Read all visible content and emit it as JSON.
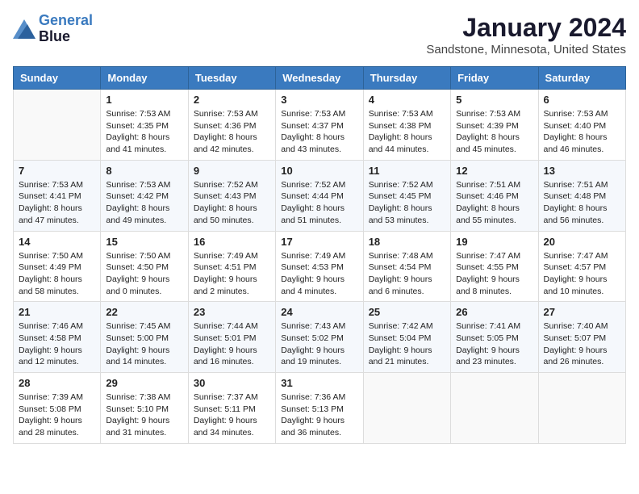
{
  "header": {
    "logo_line1": "General",
    "logo_line2": "Blue",
    "month": "January 2024",
    "location": "Sandstone, Minnesota, United States"
  },
  "days_of_week": [
    "Sunday",
    "Monday",
    "Tuesday",
    "Wednesday",
    "Thursday",
    "Friday",
    "Saturday"
  ],
  "weeks": [
    [
      {
        "day": "",
        "content": ""
      },
      {
        "day": "1",
        "content": "Sunrise: 7:53 AM\nSunset: 4:35 PM\nDaylight: 8 hours\nand 41 minutes."
      },
      {
        "day": "2",
        "content": "Sunrise: 7:53 AM\nSunset: 4:36 PM\nDaylight: 8 hours\nand 42 minutes."
      },
      {
        "day": "3",
        "content": "Sunrise: 7:53 AM\nSunset: 4:37 PM\nDaylight: 8 hours\nand 43 minutes."
      },
      {
        "day": "4",
        "content": "Sunrise: 7:53 AM\nSunset: 4:38 PM\nDaylight: 8 hours\nand 44 minutes."
      },
      {
        "day": "5",
        "content": "Sunrise: 7:53 AM\nSunset: 4:39 PM\nDaylight: 8 hours\nand 45 minutes."
      },
      {
        "day": "6",
        "content": "Sunrise: 7:53 AM\nSunset: 4:40 PM\nDaylight: 8 hours\nand 46 minutes."
      }
    ],
    [
      {
        "day": "7",
        "content": "Sunrise: 7:53 AM\nSunset: 4:41 PM\nDaylight: 8 hours\nand 47 minutes."
      },
      {
        "day": "8",
        "content": "Sunrise: 7:53 AM\nSunset: 4:42 PM\nDaylight: 8 hours\nand 49 minutes."
      },
      {
        "day": "9",
        "content": "Sunrise: 7:52 AM\nSunset: 4:43 PM\nDaylight: 8 hours\nand 50 minutes."
      },
      {
        "day": "10",
        "content": "Sunrise: 7:52 AM\nSunset: 4:44 PM\nDaylight: 8 hours\nand 51 minutes."
      },
      {
        "day": "11",
        "content": "Sunrise: 7:52 AM\nSunset: 4:45 PM\nDaylight: 8 hours\nand 53 minutes."
      },
      {
        "day": "12",
        "content": "Sunrise: 7:51 AM\nSunset: 4:46 PM\nDaylight: 8 hours\nand 55 minutes."
      },
      {
        "day": "13",
        "content": "Sunrise: 7:51 AM\nSunset: 4:48 PM\nDaylight: 8 hours\nand 56 minutes."
      }
    ],
    [
      {
        "day": "14",
        "content": "Sunrise: 7:50 AM\nSunset: 4:49 PM\nDaylight: 8 hours\nand 58 minutes."
      },
      {
        "day": "15",
        "content": "Sunrise: 7:50 AM\nSunset: 4:50 PM\nDaylight: 9 hours\nand 0 minutes."
      },
      {
        "day": "16",
        "content": "Sunrise: 7:49 AM\nSunset: 4:51 PM\nDaylight: 9 hours\nand 2 minutes."
      },
      {
        "day": "17",
        "content": "Sunrise: 7:49 AM\nSunset: 4:53 PM\nDaylight: 9 hours\nand 4 minutes."
      },
      {
        "day": "18",
        "content": "Sunrise: 7:48 AM\nSunset: 4:54 PM\nDaylight: 9 hours\nand 6 minutes."
      },
      {
        "day": "19",
        "content": "Sunrise: 7:47 AM\nSunset: 4:55 PM\nDaylight: 9 hours\nand 8 minutes."
      },
      {
        "day": "20",
        "content": "Sunrise: 7:47 AM\nSunset: 4:57 PM\nDaylight: 9 hours\nand 10 minutes."
      }
    ],
    [
      {
        "day": "21",
        "content": "Sunrise: 7:46 AM\nSunset: 4:58 PM\nDaylight: 9 hours\nand 12 minutes."
      },
      {
        "day": "22",
        "content": "Sunrise: 7:45 AM\nSunset: 5:00 PM\nDaylight: 9 hours\nand 14 minutes."
      },
      {
        "day": "23",
        "content": "Sunrise: 7:44 AM\nSunset: 5:01 PM\nDaylight: 9 hours\nand 16 minutes."
      },
      {
        "day": "24",
        "content": "Sunrise: 7:43 AM\nSunset: 5:02 PM\nDaylight: 9 hours\nand 19 minutes."
      },
      {
        "day": "25",
        "content": "Sunrise: 7:42 AM\nSunset: 5:04 PM\nDaylight: 9 hours\nand 21 minutes."
      },
      {
        "day": "26",
        "content": "Sunrise: 7:41 AM\nSunset: 5:05 PM\nDaylight: 9 hours\nand 23 minutes."
      },
      {
        "day": "27",
        "content": "Sunrise: 7:40 AM\nSunset: 5:07 PM\nDaylight: 9 hours\nand 26 minutes."
      }
    ],
    [
      {
        "day": "28",
        "content": "Sunrise: 7:39 AM\nSunset: 5:08 PM\nDaylight: 9 hours\nand 28 minutes."
      },
      {
        "day": "29",
        "content": "Sunrise: 7:38 AM\nSunset: 5:10 PM\nDaylight: 9 hours\nand 31 minutes."
      },
      {
        "day": "30",
        "content": "Sunrise: 7:37 AM\nSunset: 5:11 PM\nDaylight: 9 hours\nand 34 minutes."
      },
      {
        "day": "31",
        "content": "Sunrise: 7:36 AM\nSunset: 5:13 PM\nDaylight: 9 hours\nand 36 minutes."
      },
      {
        "day": "",
        "content": ""
      },
      {
        "day": "",
        "content": ""
      },
      {
        "day": "",
        "content": ""
      }
    ]
  ]
}
